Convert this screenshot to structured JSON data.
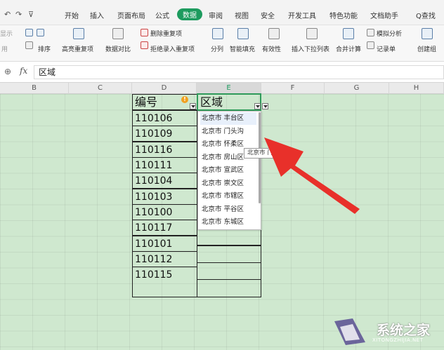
{
  "quick_access": {
    "undo": "↶",
    "redo": "↷",
    "more": "⊽"
  },
  "tabs": [
    {
      "label": "开始"
    },
    {
      "label": "插入"
    },
    {
      "label": "页面布局"
    },
    {
      "label": "公式"
    },
    {
      "label": "数据",
      "active": true
    },
    {
      "label": "审阅"
    },
    {
      "label": "视图"
    },
    {
      "label": "安全"
    },
    {
      "label": "开发工具"
    },
    {
      "label": "特色功能"
    },
    {
      "label": "文档助手"
    }
  ],
  "search_label": "Q查找",
  "ribbon": {
    "left_cut_1": "显示",
    "left_cut_2": "用",
    "sort": "排序",
    "highlight_dup": "高亮重复项",
    "data_compare": "数据对比",
    "delete_dup": "删除重复项",
    "reject_dup": "拒绝录入重复项",
    "split": "分列",
    "smart_fill": "智能填充",
    "validity": "有效性",
    "insert_dropdown": "插入下拉列表",
    "merge_calc": "合并计算",
    "simulate": "模拟分析",
    "record_sheet": "记录单",
    "create_group": "创建组"
  },
  "formula_bar": {
    "fx": "fx",
    "value": "区域"
  },
  "columns": [
    "B",
    "C",
    "D",
    "E",
    "F",
    "G",
    "H"
  ],
  "table": {
    "header_d": "编号",
    "header_e": "区域",
    "ids": [
      "110106",
      "110109",
      "110116",
      "110111",
      "110104",
      "110103",
      "110100",
      "110117",
      "110101",
      "110112",
      "110115"
    ]
  },
  "dropdown_items": [
    "北京市  丰台区",
    "北京市  门头沟",
    "北京市  怀柔区",
    "北京市  房山区",
    "北京市  宣武区",
    "北京市  崇文区",
    "北京市  市辖区",
    "北京市  平谷区",
    "北京市  东城区"
  ],
  "tooltip": "北京市  门头沟",
  "watermark": {
    "text": "系统之家",
    "sub": "XITONGZHIJIA.NET"
  },
  "colors": {
    "accent": "#1d9b5e",
    "sheet_bg": "#cfe8cf",
    "arrow": "#e8302a"
  }
}
